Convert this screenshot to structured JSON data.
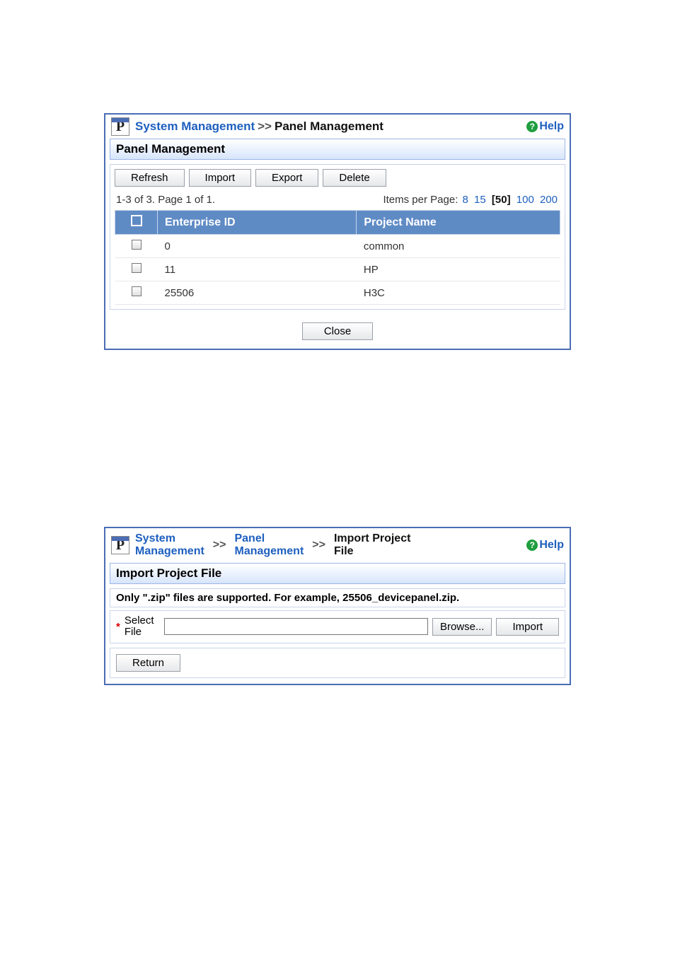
{
  "panel1": {
    "breadcrumb": {
      "link": "System Management",
      "sep": ">>",
      "current": "Panel Management"
    },
    "help": "Help",
    "title": "Panel Management",
    "toolbar": {
      "refresh": "Refresh",
      "import": "Import",
      "export": "Export",
      "delete": "Delete"
    },
    "paging": {
      "status": "1-3 of 3. Page 1 of 1.",
      "label": "Items per Page:",
      "options": [
        "8",
        "15",
        "[50]",
        "100",
        "200"
      ],
      "current_index": 2
    },
    "table": {
      "headers": {
        "col1": "Enterprise ID",
        "col2": "Project Name"
      },
      "rows": [
        {
          "enterprise_id": "0",
          "project_name": "common"
        },
        {
          "enterprise_id": "11",
          "project_name": "HP"
        },
        {
          "enterprise_id": "25506",
          "project_name": "H3C"
        }
      ]
    },
    "close": "Close"
  },
  "panel2": {
    "breadcrumb": {
      "l1a": "System",
      "l1b": "Management",
      "sep": ">>",
      "l2a": "Panel",
      "l2b": "Management",
      "l3a": "Import Project",
      "l3b": "File"
    },
    "help": "Help",
    "title": "Import Project File",
    "instruction": "Only \".zip\" files are supported. For example, 25506_devicepanel.zip.",
    "form": {
      "field_required": "*",
      "field_label": "Select File",
      "input_value": "",
      "browse": "Browse...",
      "import": "Import"
    },
    "return": "Return"
  }
}
